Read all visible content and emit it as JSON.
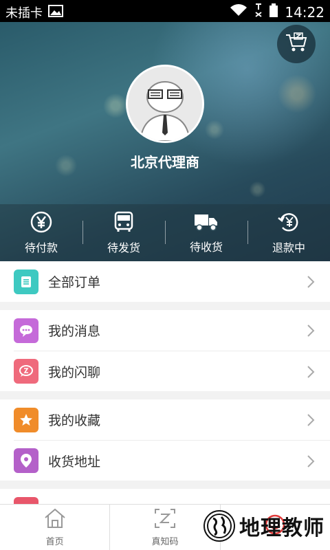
{
  "status_bar": {
    "carrier": "未插卡",
    "time": "14:22"
  },
  "profile": {
    "name": "北京代理商"
  },
  "order_states": [
    {
      "label": "待付款",
      "icon": "yen-icon"
    },
    {
      "label": "待发货",
      "icon": "bus-icon"
    },
    {
      "label": "待收货",
      "icon": "truck-icon"
    },
    {
      "label": "退款中",
      "icon": "refund-icon"
    }
  ],
  "menu_groups": [
    [
      {
        "label": "全部订单",
        "icon": "list-icon",
        "color": "#3ec9c1"
      }
    ],
    [
      {
        "label": "我的消息",
        "icon": "chat-icon",
        "color": "#c56ad9"
      },
      {
        "label": "我的闪聊",
        "icon": "flash-chat-icon",
        "color": "#ef6a7c"
      }
    ],
    [
      {
        "label": "我的收藏",
        "icon": "star-icon",
        "color": "#f08c2a"
      },
      {
        "label": "收货地址",
        "icon": "location-icon",
        "color": "#b460c9"
      }
    ]
  ],
  "tabbar": [
    {
      "label": "首页",
      "icon": "home-icon"
    },
    {
      "label": "真知码",
      "icon": "zcode-icon"
    },
    {
      "label": "",
      "icon": "smile-icon"
    }
  ],
  "watermark": {
    "text": "地理教师"
  }
}
